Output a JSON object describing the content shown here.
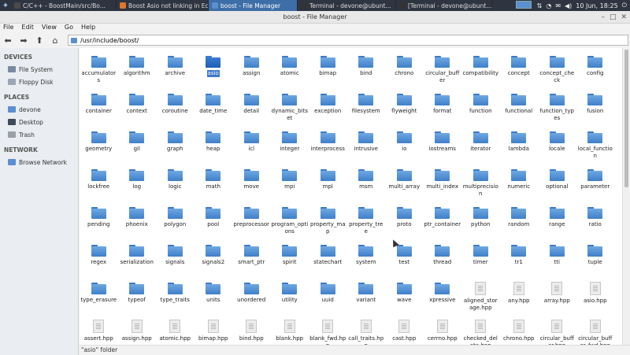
{
  "taskbar": {
    "tasks": [
      {
        "label": "C/C++ - BoostMain/src/Bo...",
        "icon": "eclipse-icon",
        "color": "#4a4a4a"
      },
      {
        "label": "Boost Asio not linking in Ec...",
        "icon": "firefox-icon",
        "color": "#e0762c"
      },
      {
        "label": "boost - File Manager",
        "icon": "folder-icon",
        "color": "#5b8fd0",
        "active": true
      },
      {
        "label": "Terminal - devone@ubunt...",
        "icon": "terminal-icon",
        "color": "#333333"
      },
      {
        "label": "[Terminal - devone@ubunt...",
        "icon": "terminal-icon",
        "color": "#333333"
      }
    ],
    "clock": "10 Jun, 18:25"
  },
  "window": {
    "title": "boost - File Manager"
  },
  "menu": {
    "items": [
      "File",
      "Edit",
      "View",
      "Go",
      "Help"
    ]
  },
  "toolbar": {
    "path": "/usr/include/boost/"
  },
  "sidebar": {
    "devices_label": "DEVICES",
    "devices": [
      {
        "label": "File System",
        "icon": "drive-icon",
        "color": "#7a8aa0"
      },
      {
        "label": "Floppy Disk",
        "icon": "floppy-icon",
        "color": "#9aa6b8"
      }
    ],
    "places_label": "PLACES",
    "places": [
      {
        "label": "devone",
        "icon": "home-icon",
        "color": "#5b8fd0"
      },
      {
        "label": "Desktop",
        "icon": "desktop-icon",
        "color": "#3d4a5c"
      },
      {
        "label": "Trash",
        "icon": "trash-icon",
        "color": "#9aa0a6"
      }
    ],
    "network_label": "NETWORK",
    "network": [
      {
        "label": "Browse Network",
        "icon": "network-icon",
        "color": "#5b8fd0"
      }
    ]
  },
  "items": [
    {
      "name": "accumulators",
      "type": "folder"
    },
    {
      "name": "algorithm",
      "type": "folder"
    },
    {
      "name": "archive",
      "type": "folder"
    },
    {
      "name": "asio",
      "type": "folder",
      "selected": true
    },
    {
      "name": "assign",
      "type": "folder"
    },
    {
      "name": "atomic",
      "type": "folder"
    },
    {
      "name": "bimap",
      "type": "folder"
    },
    {
      "name": "bind",
      "type": "folder"
    },
    {
      "name": "chrono",
      "type": "folder"
    },
    {
      "name": "circular_buffer",
      "type": "folder"
    },
    {
      "name": "compatibility",
      "type": "folder"
    },
    {
      "name": "concept",
      "type": "folder"
    },
    {
      "name": "concept_check",
      "type": "folder"
    },
    {
      "name": "config",
      "type": "folder"
    },
    {
      "name": "container",
      "type": "folder"
    },
    {
      "name": "context",
      "type": "folder"
    },
    {
      "name": "coroutine",
      "type": "folder"
    },
    {
      "name": "date_time",
      "type": "folder"
    },
    {
      "name": "detail",
      "type": "folder"
    },
    {
      "name": "dynamic_bitset",
      "type": "folder"
    },
    {
      "name": "exception",
      "type": "folder"
    },
    {
      "name": "filesystem",
      "type": "folder"
    },
    {
      "name": "flyweight",
      "type": "folder"
    },
    {
      "name": "format",
      "type": "folder"
    },
    {
      "name": "function",
      "type": "folder"
    },
    {
      "name": "functional",
      "type": "folder"
    },
    {
      "name": "function_types",
      "type": "folder"
    },
    {
      "name": "fusion",
      "type": "folder"
    },
    {
      "name": "geometry",
      "type": "folder"
    },
    {
      "name": "gil",
      "type": "folder"
    },
    {
      "name": "graph",
      "type": "folder"
    },
    {
      "name": "heap",
      "type": "folder"
    },
    {
      "name": "icl",
      "type": "folder"
    },
    {
      "name": "integer",
      "type": "folder"
    },
    {
      "name": "interprocess",
      "type": "folder"
    },
    {
      "name": "intrusive",
      "type": "folder"
    },
    {
      "name": "io",
      "type": "folder"
    },
    {
      "name": "iostreams",
      "type": "folder"
    },
    {
      "name": "iterator",
      "type": "folder"
    },
    {
      "name": "lambda",
      "type": "folder"
    },
    {
      "name": "locale",
      "type": "folder"
    },
    {
      "name": "local_function",
      "type": "folder"
    },
    {
      "name": "lockfree",
      "type": "folder"
    },
    {
      "name": "log",
      "type": "folder"
    },
    {
      "name": "logic",
      "type": "folder"
    },
    {
      "name": "math",
      "type": "folder"
    },
    {
      "name": "move",
      "type": "folder"
    },
    {
      "name": "mpi",
      "type": "folder"
    },
    {
      "name": "mpl",
      "type": "folder"
    },
    {
      "name": "msm",
      "type": "folder"
    },
    {
      "name": "multi_array",
      "type": "folder"
    },
    {
      "name": "multi_index",
      "type": "folder"
    },
    {
      "name": "multiprecision",
      "type": "folder"
    },
    {
      "name": "numeric",
      "type": "folder"
    },
    {
      "name": "optional",
      "type": "folder"
    },
    {
      "name": "parameter",
      "type": "folder"
    },
    {
      "name": "pending",
      "type": "folder"
    },
    {
      "name": "phoenix",
      "type": "folder"
    },
    {
      "name": "polygon",
      "type": "folder"
    },
    {
      "name": "pool",
      "type": "folder"
    },
    {
      "name": "preprocessor",
      "type": "folder"
    },
    {
      "name": "program_options",
      "type": "folder"
    },
    {
      "name": "property_map",
      "type": "folder"
    },
    {
      "name": "property_tree",
      "type": "folder"
    },
    {
      "name": "proto",
      "type": "folder"
    },
    {
      "name": "ptr_container",
      "type": "folder"
    },
    {
      "name": "python",
      "type": "folder"
    },
    {
      "name": "random",
      "type": "folder"
    },
    {
      "name": "range",
      "type": "folder"
    },
    {
      "name": "ratio",
      "type": "folder"
    },
    {
      "name": "regex",
      "type": "folder"
    },
    {
      "name": "serialization",
      "type": "folder"
    },
    {
      "name": "signals",
      "type": "folder"
    },
    {
      "name": "signals2",
      "type": "folder"
    },
    {
      "name": "smart_ptr",
      "type": "folder"
    },
    {
      "name": "spirit",
      "type": "folder"
    },
    {
      "name": "statechart",
      "type": "folder"
    },
    {
      "name": "system",
      "type": "folder"
    },
    {
      "name": "test",
      "type": "folder"
    },
    {
      "name": "thread",
      "type": "folder"
    },
    {
      "name": "timer",
      "type": "folder"
    },
    {
      "name": "tr1",
      "type": "folder"
    },
    {
      "name": "tti",
      "type": "folder"
    },
    {
      "name": "tuple",
      "type": "folder"
    },
    {
      "name": "type_erasure",
      "type": "folder"
    },
    {
      "name": "typeof",
      "type": "folder"
    },
    {
      "name": "type_traits",
      "type": "folder"
    },
    {
      "name": "units",
      "type": "folder"
    },
    {
      "name": "unordered",
      "type": "folder"
    },
    {
      "name": "utility",
      "type": "folder"
    },
    {
      "name": "uuid",
      "type": "folder"
    },
    {
      "name": "variant",
      "type": "folder"
    },
    {
      "name": "wave",
      "type": "folder"
    },
    {
      "name": "xpressive",
      "type": "folder"
    },
    {
      "name": "aligned_storage.hpp",
      "type": "file"
    },
    {
      "name": "any.hpp",
      "type": "file"
    },
    {
      "name": "array.hpp",
      "type": "file"
    },
    {
      "name": "asio.hpp",
      "type": "file"
    },
    {
      "name": "assert.hpp",
      "type": "file"
    },
    {
      "name": "assign.hpp",
      "type": "file"
    },
    {
      "name": "atomic.hpp",
      "type": "file"
    },
    {
      "name": "bimap.hpp",
      "type": "file"
    },
    {
      "name": "bind.hpp",
      "type": "file"
    },
    {
      "name": "blank.hpp",
      "type": "file"
    },
    {
      "name": "blank_fwd.hpp",
      "type": "file"
    },
    {
      "name": "call_traits.hpp",
      "type": "file"
    },
    {
      "name": "cast.hpp",
      "type": "file"
    },
    {
      "name": "cerrno.hpp",
      "type": "file"
    },
    {
      "name": "checked_delete.hpp",
      "type": "file"
    },
    {
      "name": "chrono.hpp",
      "type": "file"
    },
    {
      "name": "circular_buffer.hpp",
      "type": "file"
    },
    {
      "name": "circular_buffer_fwd.hpp",
      "type": "file"
    }
  ],
  "status": "\"asio\" folder"
}
